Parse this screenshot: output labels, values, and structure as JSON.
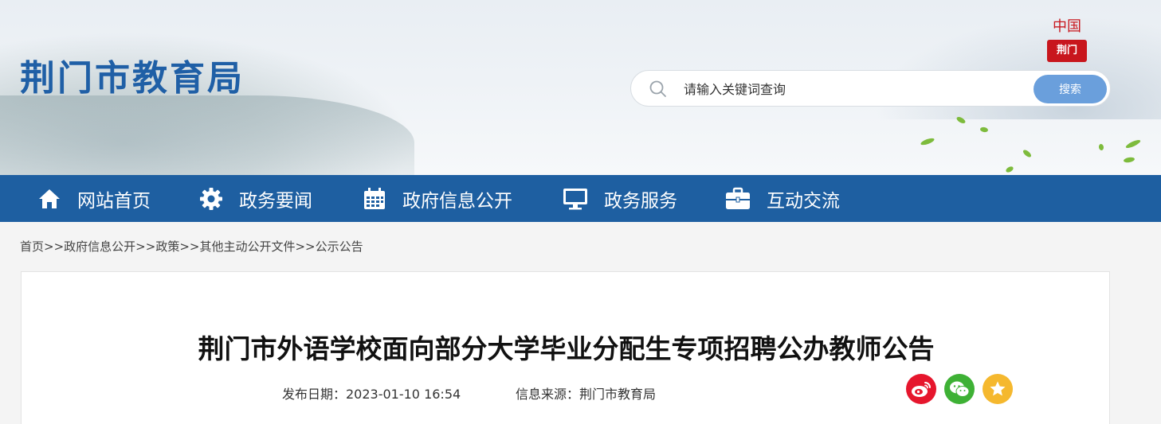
{
  "header": {
    "site_title": "荆门市教育局",
    "logo_top": "中国",
    "logo_stamp": "荆门"
  },
  "search": {
    "placeholder": "请输入关键词查询",
    "button_label": "搜索"
  },
  "nav": {
    "items": [
      {
        "label": "网站首页",
        "icon": "home-icon"
      },
      {
        "label": "政务要闻",
        "icon": "gear-icon"
      },
      {
        "label": "政府信息公开",
        "icon": "calendar-icon"
      },
      {
        "label": "政务服务",
        "icon": "monitor-icon"
      },
      {
        "label": "互动交流",
        "icon": "briefcase-icon"
      }
    ]
  },
  "breadcrumb": {
    "items": [
      "首页",
      "政府信息公开",
      "政策",
      "其他主动公开文件",
      "公示公告"
    ],
    "separator": ">>"
  },
  "article": {
    "title": "荆门市外语学校面向部分大学毕业分配生专项招聘公办教师公告",
    "date_label": "发布日期：2023-01-10 16:54",
    "source_label": "信息来源：荆门市教育局"
  },
  "share": {
    "items": [
      "weibo-icon",
      "wechat-icon",
      "favorite-star-icon"
    ]
  },
  "colors": {
    "nav_bg": "#1e5fa1",
    "title_blue": "#1f5fa6",
    "search_btn": "#6a9fdc",
    "weibo": "#e6162d",
    "wechat": "#3eb135",
    "favorite": "#f5b82e"
  }
}
